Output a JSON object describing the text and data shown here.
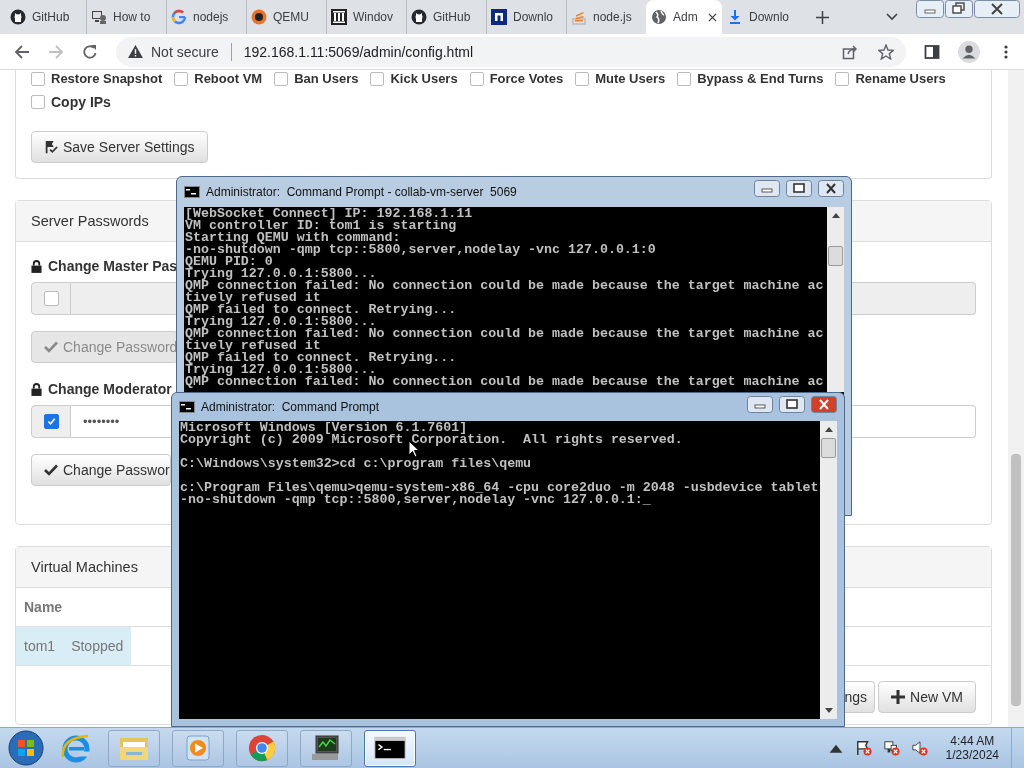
{
  "browser": {
    "tabs": [
      {
        "title": "GitHub",
        "selected": false
      },
      {
        "title": "How to",
        "selected": false
      },
      {
        "title": "nodejs",
        "selected": false
      },
      {
        "title": "QEMU",
        "selected": false
      },
      {
        "title": "Windov",
        "selected": false
      },
      {
        "title": "GitHub",
        "selected": false
      },
      {
        "title": "Downlo",
        "selected": false
      },
      {
        "title": "node.js",
        "selected": false
      },
      {
        "title": "Adm",
        "selected": true
      },
      {
        "title": "Downlo",
        "selected": false
      }
    ],
    "security": "Not secure",
    "url": "192.168.1.11:5069/admin/config.html"
  },
  "page": {
    "permissions": [
      {
        "label": "Restore Snapshot",
        "checked": false
      },
      {
        "label": "Reboot VM",
        "checked": false
      },
      {
        "label": "Ban Users",
        "checked": false
      },
      {
        "label": "Kick Users",
        "checked": false
      },
      {
        "label": "Force Votes",
        "checked": false
      },
      {
        "label": "Mute Users",
        "checked": false
      },
      {
        "label": "Bypass & End Turns",
        "checked": false
      },
      {
        "label": "Rename Users",
        "checked": false
      },
      {
        "label": "Copy IPs",
        "checked": false
      }
    ],
    "save_button": "Save Server Settings",
    "passwords": {
      "title": "Server Passwords",
      "groups": [
        {
          "heading": "Change Master Pas",
          "checked": false,
          "button": "Change Password",
          "disabled": true
        },
        {
          "heading": "Change Moderator",
          "checked": true,
          "value": "••••••••",
          "button": "Change Passwor",
          "disabled": false
        }
      ]
    },
    "vms": {
      "title": "Virtual Machines",
      "columns": [
        "Name"
      ],
      "rows": [
        {
          "name": "tom1",
          "status": "Stopped",
          "selected": true
        }
      ],
      "buttons": [
        "ngs",
        "New VM"
      ]
    }
  },
  "consoles": [
    {
      "title": "Administrator:  Command Prompt - collab-vm-server  5069",
      "active": false,
      "blocks": [
        [
          "[WebSocket Connect] IP: 192.168.1.11",
          "VM controller ID: tom1 is starting",
          "Starting QEMU with command:",
          "-no-shutdown -qmp tcp::5800,server,nodelay -vnc 127.0.0.1:0",
          "QEMU PID: 0",
          "Trying 127.0.0.1:5800...",
          "QMP connection failed: No connection could be made because the target machine ac",
          "tively refused it",
          "QMP failed to connect. Retrying...",
          "Trying 127.0.0.1:5800...",
          "QMP connection failed: No connection could be made because the target machine ac",
          "tively refused it",
          "QMP failed to connect. Retrying...",
          "Trying 127.0.0.1:5800...",
          "QMP connection failed: No connection could be made because the target machine ac"
        ]
      ]
    },
    {
      "title": "Administrator:  Command Prompt",
      "active": true,
      "blocks": [
        [
          "Microsoft Windows [Version 6.1.7601]",
          "Copyright (c) 2009 Microsoft Corporation.  All rights reserved."
        ],
        [
          "C:\\Windows\\system32>cd c:\\program files\\qemu"
        ],
        [
          "c:\\Program Files\\qemu>qemu-system-x86_64 -cpu core2duo -m 2048 -usbdevice tablet",
          "-no-shutdown -qmp tcp::5800,server,nodelay -vnc 127.0.0.1:_"
        ]
      ]
    }
  ],
  "taskbar": {
    "apps": [
      {
        "active": false
      },
      {
        "active": false
      },
      {
        "active": false
      },
      {
        "active": false
      },
      {
        "active": true
      }
    ],
    "time": "4:44 AM",
    "date": "1/23/2024"
  }
}
